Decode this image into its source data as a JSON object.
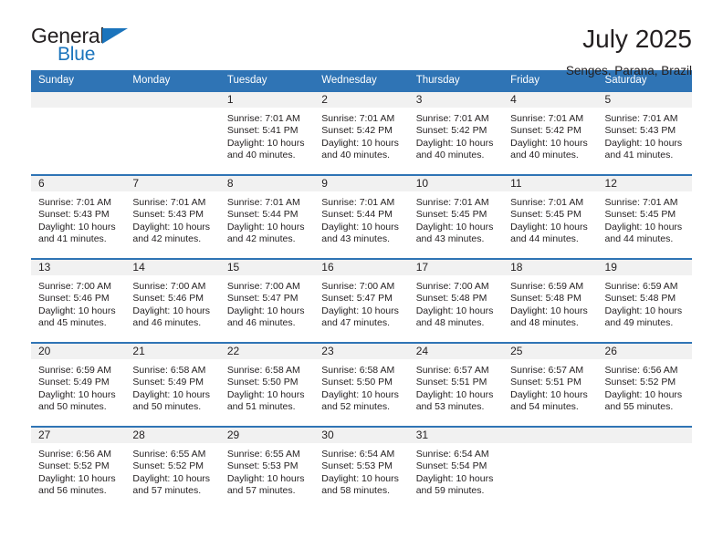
{
  "brand": {
    "name_part1": "General",
    "name_part2": "Blue",
    "accent_color": "#1b74bc"
  },
  "header": {
    "title": "July 2025",
    "subtitle": "Senges, Parana, Brazil"
  },
  "theme": {
    "header_blue": "#2f74b5",
    "day_band_gray": "#f1f1f1",
    "text_color": "#231f20"
  },
  "calendar": {
    "weekday_headers": [
      "Sunday",
      "Monday",
      "Tuesday",
      "Wednesday",
      "Thursday",
      "Friday",
      "Saturday"
    ],
    "weeks": [
      [
        {
          "day": "",
          "sunrise": "",
          "sunset": "",
          "daylight_line1": "",
          "daylight_line2": ""
        },
        {
          "day": "",
          "sunrise": "",
          "sunset": "",
          "daylight_line1": "",
          "daylight_line2": ""
        },
        {
          "day": "1",
          "sunrise": "Sunrise: 7:01 AM",
          "sunset": "Sunset: 5:41 PM",
          "daylight_line1": "Daylight: 10 hours",
          "daylight_line2": "and 40 minutes."
        },
        {
          "day": "2",
          "sunrise": "Sunrise: 7:01 AM",
          "sunset": "Sunset: 5:42 PM",
          "daylight_line1": "Daylight: 10 hours",
          "daylight_line2": "and 40 minutes."
        },
        {
          "day": "3",
          "sunrise": "Sunrise: 7:01 AM",
          "sunset": "Sunset: 5:42 PM",
          "daylight_line1": "Daylight: 10 hours",
          "daylight_line2": "and 40 minutes."
        },
        {
          "day": "4",
          "sunrise": "Sunrise: 7:01 AM",
          "sunset": "Sunset: 5:42 PM",
          "daylight_line1": "Daylight: 10 hours",
          "daylight_line2": "and 40 minutes."
        },
        {
          "day": "5",
          "sunrise": "Sunrise: 7:01 AM",
          "sunset": "Sunset: 5:43 PM",
          "daylight_line1": "Daylight: 10 hours",
          "daylight_line2": "and 41 minutes."
        }
      ],
      [
        {
          "day": "6",
          "sunrise": "Sunrise: 7:01 AM",
          "sunset": "Sunset: 5:43 PM",
          "daylight_line1": "Daylight: 10 hours",
          "daylight_line2": "and 41 minutes."
        },
        {
          "day": "7",
          "sunrise": "Sunrise: 7:01 AM",
          "sunset": "Sunset: 5:43 PM",
          "daylight_line1": "Daylight: 10 hours",
          "daylight_line2": "and 42 minutes."
        },
        {
          "day": "8",
          "sunrise": "Sunrise: 7:01 AM",
          "sunset": "Sunset: 5:44 PM",
          "daylight_line1": "Daylight: 10 hours",
          "daylight_line2": "and 42 minutes."
        },
        {
          "day": "9",
          "sunrise": "Sunrise: 7:01 AM",
          "sunset": "Sunset: 5:44 PM",
          "daylight_line1": "Daylight: 10 hours",
          "daylight_line2": "and 43 minutes."
        },
        {
          "day": "10",
          "sunrise": "Sunrise: 7:01 AM",
          "sunset": "Sunset: 5:45 PM",
          "daylight_line1": "Daylight: 10 hours",
          "daylight_line2": "and 43 minutes."
        },
        {
          "day": "11",
          "sunrise": "Sunrise: 7:01 AM",
          "sunset": "Sunset: 5:45 PM",
          "daylight_line1": "Daylight: 10 hours",
          "daylight_line2": "and 44 minutes."
        },
        {
          "day": "12",
          "sunrise": "Sunrise: 7:01 AM",
          "sunset": "Sunset: 5:45 PM",
          "daylight_line1": "Daylight: 10 hours",
          "daylight_line2": "and 44 minutes."
        }
      ],
      [
        {
          "day": "13",
          "sunrise": "Sunrise: 7:00 AM",
          "sunset": "Sunset: 5:46 PM",
          "daylight_line1": "Daylight: 10 hours",
          "daylight_line2": "and 45 minutes."
        },
        {
          "day": "14",
          "sunrise": "Sunrise: 7:00 AM",
          "sunset": "Sunset: 5:46 PM",
          "daylight_line1": "Daylight: 10 hours",
          "daylight_line2": "and 46 minutes."
        },
        {
          "day": "15",
          "sunrise": "Sunrise: 7:00 AM",
          "sunset": "Sunset: 5:47 PM",
          "daylight_line1": "Daylight: 10 hours",
          "daylight_line2": "and 46 minutes."
        },
        {
          "day": "16",
          "sunrise": "Sunrise: 7:00 AM",
          "sunset": "Sunset: 5:47 PM",
          "daylight_line1": "Daylight: 10 hours",
          "daylight_line2": "and 47 minutes."
        },
        {
          "day": "17",
          "sunrise": "Sunrise: 7:00 AM",
          "sunset": "Sunset: 5:48 PM",
          "daylight_line1": "Daylight: 10 hours",
          "daylight_line2": "and 48 minutes."
        },
        {
          "day": "18",
          "sunrise": "Sunrise: 6:59 AM",
          "sunset": "Sunset: 5:48 PM",
          "daylight_line1": "Daylight: 10 hours",
          "daylight_line2": "and 48 minutes."
        },
        {
          "day": "19",
          "sunrise": "Sunrise: 6:59 AM",
          "sunset": "Sunset: 5:48 PM",
          "daylight_line1": "Daylight: 10 hours",
          "daylight_line2": "and 49 minutes."
        }
      ],
      [
        {
          "day": "20",
          "sunrise": "Sunrise: 6:59 AM",
          "sunset": "Sunset: 5:49 PM",
          "daylight_line1": "Daylight: 10 hours",
          "daylight_line2": "and 50 minutes."
        },
        {
          "day": "21",
          "sunrise": "Sunrise: 6:58 AM",
          "sunset": "Sunset: 5:49 PM",
          "daylight_line1": "Daylight: 10 hours",
          "daylight_line2": "and 50 minutes."
        },
        {
          "day": "22",
          "sunrise": "Sunrise: 6:58 AM",
          "sunset": "Sunset: 5:50 PM",
          "daylight_line1": "Daylight: 10 hours",
          "daylight_line2": "and 51 minutes."
        },
        {
          "day": "23",
          "sunrise": "Sunrise: 6:58 AM",
          "sunset": "Sunset: 5:50 PM",
          "daylight_line1": "Daylight: 10 hours",
          "daylight_line2": "and 52 minutes."
        },
        {
          "day": "24",
          "sunrise": "Sunrise: 6:57 AM",
          "sunset": "Sunset: 5:51 PM",
          "daylight_line1": "Daylight: 10 hours",
          "daylight_line2": "and 53 minutes."
        },
        {
          "day": "25",
          "sunrise": "Sunrise: 6:57 AM",
          "sunset": "Sunset: 5:51 PM",
          "daylight_line1": "Daylight: 10 hours",
          "daylight_line2": "and 54 minutes."
        },
        {
          "day": "26",
          "sunrise": "Sunrise: 6:56 AM",
          "sunset": "Sunset: 5:52 PM",
          "daylight_line1": "Daylight: 10 hours",
          "daylight_line2": "and 55 minutes."
        }
      ],
      [
        {
          "day": "27",
          "sunrise": "Sunrise: 6:56 AM",
          "sunset": "Sunset: 5:52 PM",
          "daylight_line1": "Daylight: 10 hours",
          "daylight_line2": "and 56 minutes."
        },
        {
          "day": "28",
          "sunrise": "Sunrise: 6:55 AM",
          "sunset": "Sunset: 5:52 PM",
          "daylight_line1": "Daylight: 10 hours",
          "daylight_line2": "and 57 minutes."
        },
        {
          "day": "29",
          "sunrise": "Sunrise: 6:55 AM",
          "sunset": "Sunset: 5:53 PM",
          "daylight_line1": "Daylight: 10 hours",
          "daylight_line2": "and 57 minutes."
        },
        {
          "day": "30",
          "sunrise": "Sunrise: 6:54 AM",
          "sunset": "Sunset: 5:53 PM",
          "daylight_line1": "Daylight: 10 hours",
          "daylight_line2": "and 58 minutes."
        },
        {
          "day": "31",
          "sunrise": "Sunrise: 6:54 AM",
          "sunset": "Sunset: 5:54 PM",
          "daylight_line1": "Daylight: 10 hours",
          "daylight_line2": "and 59 minutes."
        },
        {
          "day": "",
          "sunrise": "",
          "sunset": "",
          "daylight_line1": "",
          "daylight_line2": ""
        },
        {
          "day": "",
          "sunrise": "",
          "sunset": "",
          "daylight_line1": "",
          "daylight_line2": ""
        }
      ]
    ]
  }
}
